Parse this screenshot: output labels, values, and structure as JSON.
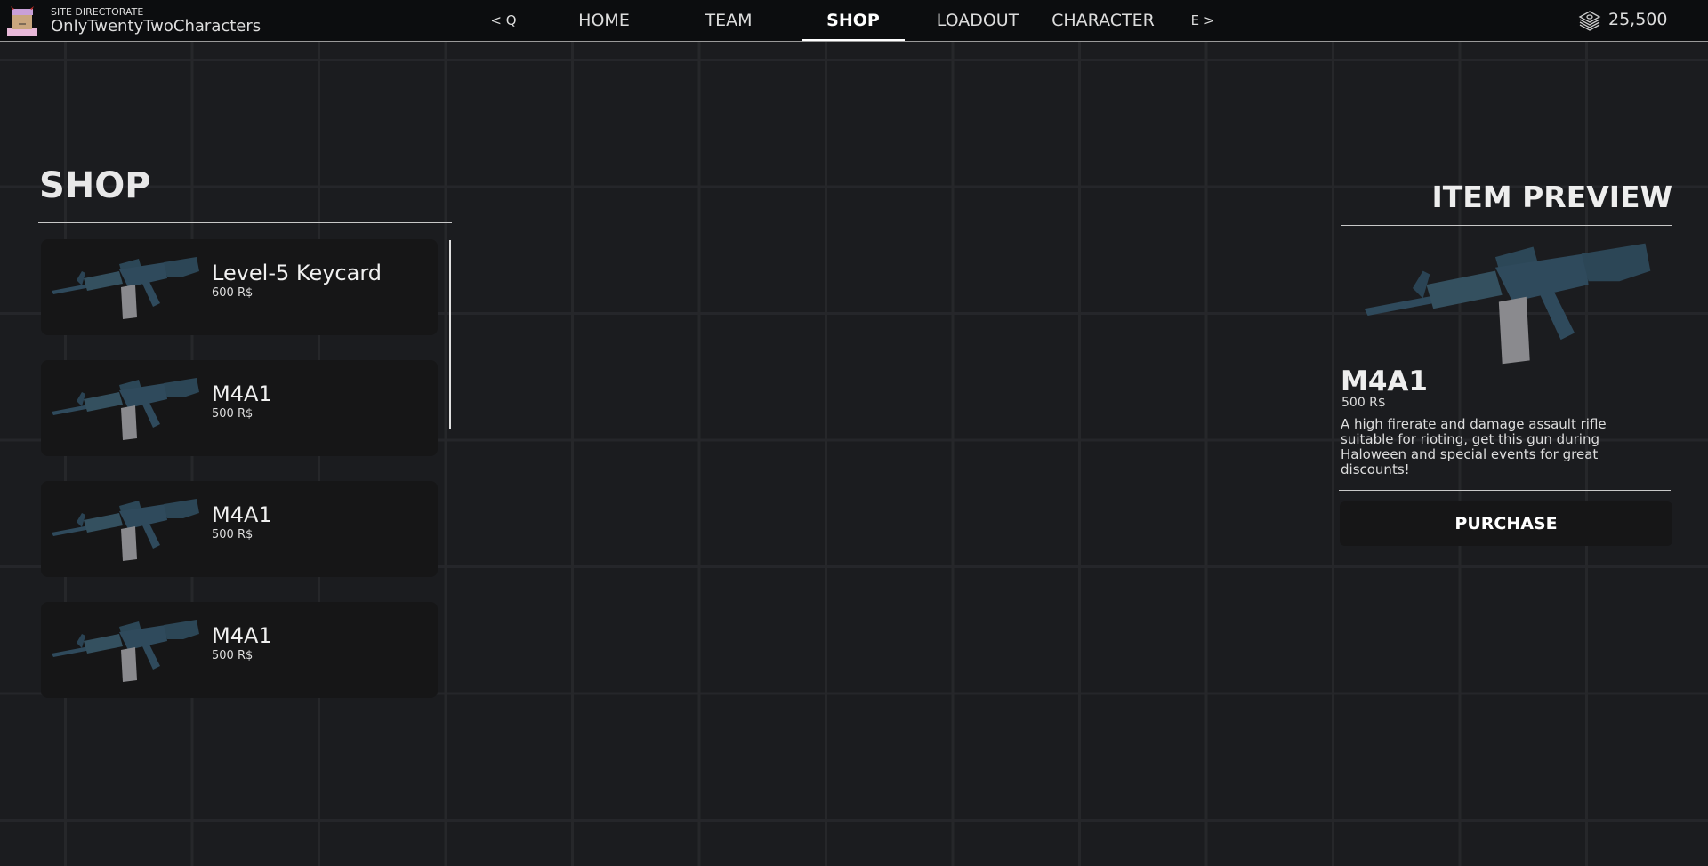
{
  "topbar": {
    "site_label": "SITE DIRECTORATE",
    "username": "OnlyTwentyTwoCharacters",
    "nav_prev": "< Q",
    "nav_next": "E >",
    "tabs": [
      {
        "label": "HOME"
      },
      {
        "label": "TEAM"
      },
      {
        "label": "SHOP"
      },
      {
        "label": "LOADOUT"
      },
      {
        "label": "CHARACTER"
      }
    ],
    "active_tab": "SHOP",
    "currency": "25,500"
  },
  "shop": {
    "title": "SHOP",
    "items": [
      {
        "name": "Level-5 Keycard",
        "price": "600 R$"
      },
      {
        "name": "M4A1",
        "price": "500 R$"
      },
      {
        "name": "M4A1",
        "price": "500 R$"
      },
      {
        "name": "M4A1",
        "price": "500 R$"
      }
    ]
  },
  "preview": {
    "title": "ITEM PREVIEW",
    "name": "M4A1",
    "price": "500 R$",
    "description": "A high firerate and damage assault rifle suitable for rioting, get this gun during Haloween and special events for great discounts!",
    "purchase_label": "PURCHASE"
  },
  "colors": {
    "gun": "#2f4a5c",
    "magazine": "#8a8a8e",
    "background": "#1b1c1f"
  }
}
